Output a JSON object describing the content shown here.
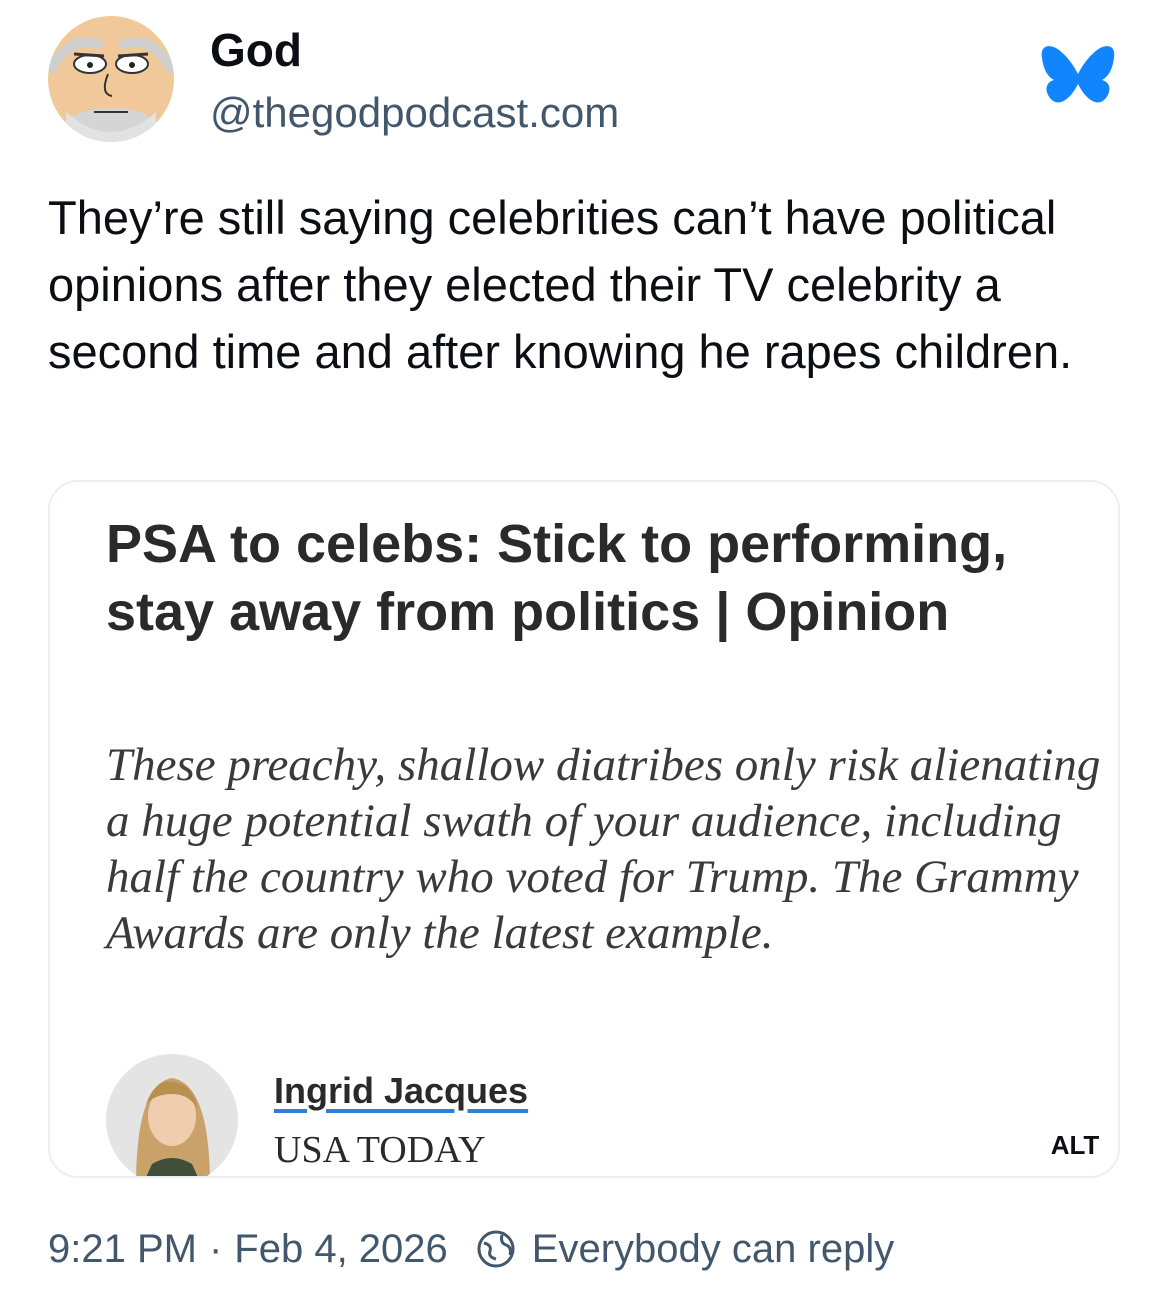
{
  "author": {
    "display_name": "God",
    "handle": "@thegodpodcast.com",
    "avatar_icon": "cartoon-face-avatar"
  },
  "app": {
    "logo_icon": "bluesky-butterfly-icon",
    "logo_color": "#1185fe"
  },
  "post": {
    "text": "They’re still saying celebrities can’t have political opinions after they elected their TV celebrity a second time and after knowing he rapes children."
  },
  "embed": {
    "headline": "PSA to celebs: Stick to performing, stay away from politics | Opinion",
    "subhead": "These preachy, shallow diatribes only risk alienating a huge potential swath of your audience, including half the country who voted for Trump. The Grammy Awards are only the latest example.",
    "author_name": "Ingrid Jacques",
    "outlet": "USA TODAY",
    "alt_label": "ALT",
    "author_name_underline_color": "#2f7fd4"
  },
  "meta": {
    "time": "9:21 PM",
    "separator": "·",
    "date": "Feb 4, 2026",
    "reply_setting_icon": "globe-reply-icon",
    "reply_setting": "Everybody can reply"
  }
}
